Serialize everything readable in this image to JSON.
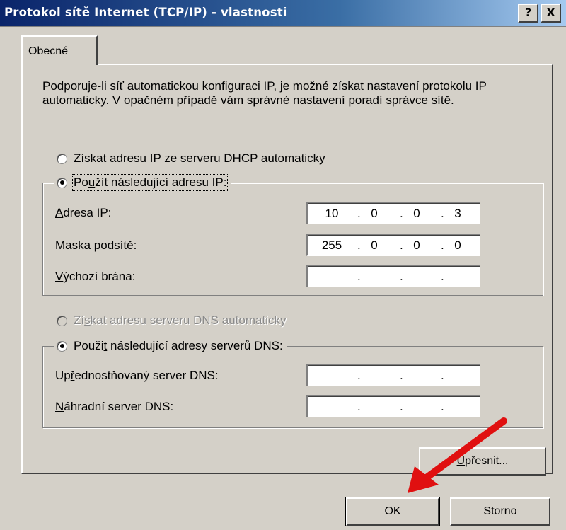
{
  "window": {
    "title": "Protokol sítě Internet (TCP/IP) - vlastnosti",
    "help_button": "?",
    "close_button": "X"
  },
  "tabs": [
    {
      "label": "Obecné",
      "selected": true
    }
  ],
  "description": "Podporuje-li síť automatickou konfiguraci IP, je možné získat nastavení protokolu IP automaticky. V opačném případě vám správné nastavení poradí správce sítě.",
  "ip_section": {
    "auto": {
      "label_pre": "",
      "label_u": "Z",
      "label_post": "ískat adresu IP ze serveru DHCP automaticky",
      "checked": false
    },
    "manual": {
      "label_pre": "Po",
      "label_u": "u",
      "label_post": "žít následující adresu IP:",
      "checked": true
    },
    "fields": [
      {
        "label_u": "A",
        "label_post": "dresa IP:",
        "octets": [
          "10",
          "0",
          "0",
          "3"
        ]
      },
      {
        "label_u": "M",
        "label_post": "aska podsítě:",
        "octets": [
          "255",
          "0",
          "0",
          "0"
        ]
      },
      {
        "label_u": "V",
        "label_post": "ýchozí brána:",
        "octets": [
          "",
          "",
          "",
          ""
        ]
      }
    ]
  },
  "dns_section": {
    "auto": {
      "label_pre": "Zí",
      "label_u": "s",
      "label_post": "kat adresu serveru DNS automaticky",
      "checked": false,
      "disabled": true
    },
    "manual": {
      "label_pre": "Použi",
      "label_u": "t",
      "label_post": " následující adresy serverů DNS:",
      "checked": true
    },
    "fields": [
      {
        "label_pre": "Up",
        "label_u": "ř",
        "label_post": "ednostňovaný server DNS:",
        "octets": [
          "",
          "",
          "",
          ""
        ]
      },
      {
        "label_pre": "",
        "label_u": "N",
        "label_post": "áhradní server DNS:",
        "octets": [
          "",
          "",
          "",
          ""
        ]
      }
    ]
  },
  "buttons": {
    "advanced": {
      "label_u": "U",
      "label_post": "přesnit..."
    },
    "ok": "OK",
    "cancel": "Storno"
  },
  "colors": {
    "annotation_arrow": "#e01010",
    "titlebar_start": "#0a246a",
    "dialog_face": "#d4d0c8"
  }
}
